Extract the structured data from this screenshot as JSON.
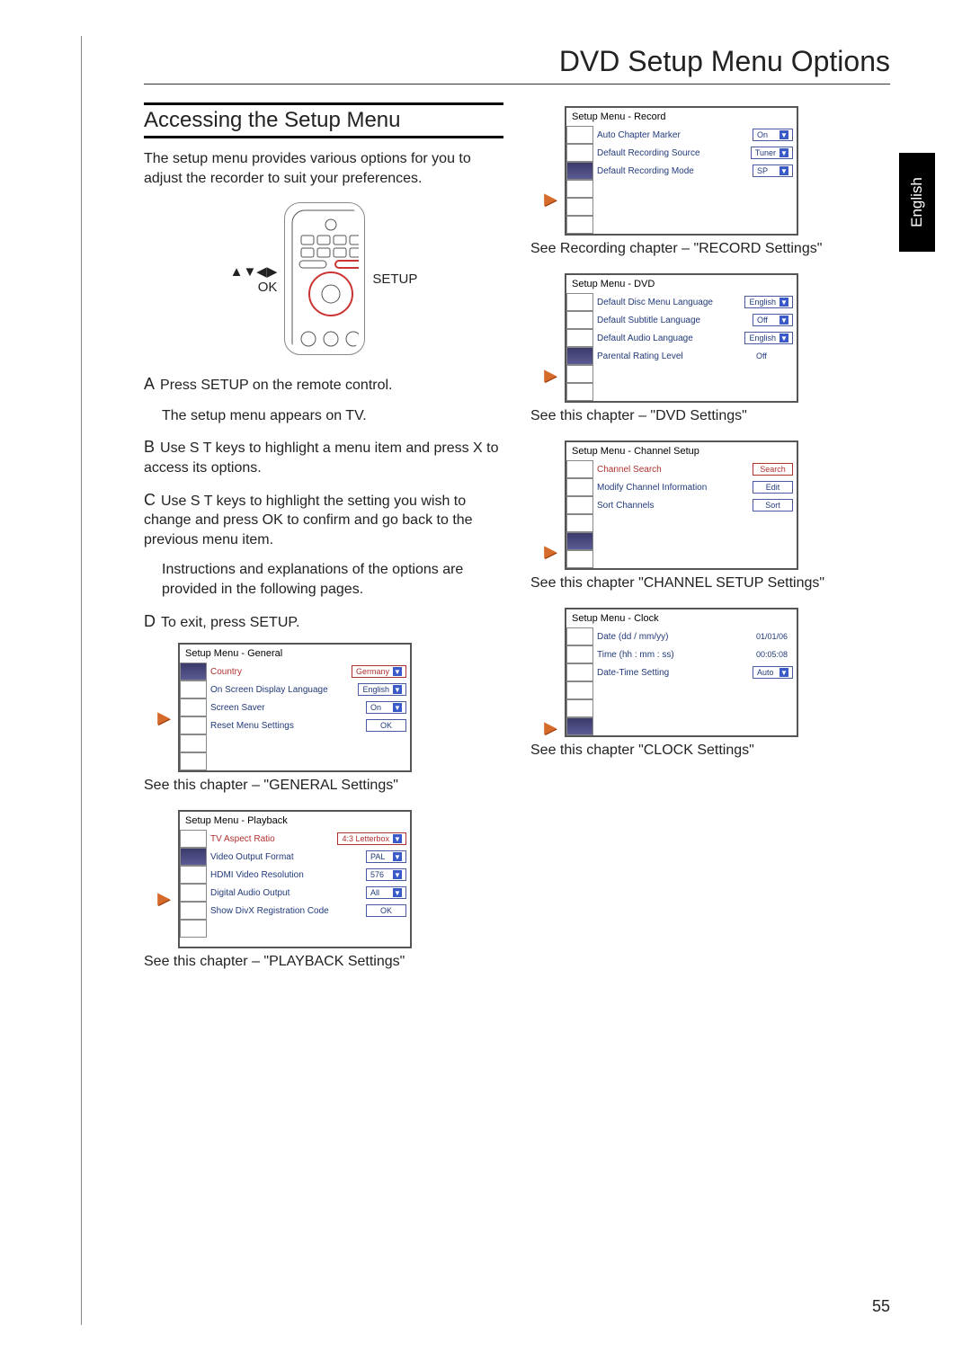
{
  "page_title": "DVD Setup Menu Options",
  "language_tab": "English",
  "page_number": "55",
  "section_heading": "Accessing the Setup Menu",
  "intro": "The setup menu provides various options for you to adjust the recorder to suit your preferences.",
  "remote": {
    "setup_label": "SETUP",
    "arrows_label": "▲▼◀▶",
    "ok_label": "OK"
  },
  "steps": {
    "A": "Press SETUP on the remote control.",
    "A_sub": "The setup menu appears on TV.",
    "B": "Use S T keys to highlight a menu item and press X to access its options.",
    "C": "Use S T keys to highlight the setting you wish to change and press OK to confirm and go back to the previous menu item.",
    "C_sub": "Instructions and explanations of the options are provided in the following pages.",
    "D": "To exit, press SETUP."
  },
  "captions": {
    "general": "See this chapter – \"GENERAL Settings\"",
    "playback": "See this chapter – \"PLAYBACK Settings\"",
    "record": "See Recording chapter – \"RECORD Settings\"",
    "dvd": "See this chapter – \"DVD Settings\"",
    "channel": "See this chapter \"CHANNEL SETUP Settings\"",
    "clock": "See this chapter \"CLOCK Settings\""
  },
  "menus": {
    "general": {
      "title": "Setup Menu - General",
      "rows": [
        {
          "label": "Country",
          "value": "Germany",
          "hl": true,
          "dd": true
        },
        {
          "label": "On Screen Display Language",
          "value": "English",
          "dd": true
        },
        {
          "label": "Screen Saver",
          "value": "On",
          "dd": true
        },
        {
          "label": "Reset Menu Settings",
          "value": "OK",
          "plain": true
        }
      ]
    },
    "playback": {
      "title": "Setup Menu - Playback",
      "rows": [
        {
          "label": "TV Aspect Ratio",
          "value": "4:3 Letterbox",
          "hl": true,
          "dd": true
        },
        {
          "label": "Video Output Format",
          "value": "PAL",
          "dd": true
        },
        {
          "label": "HDMI Video Resolution",
          "value": "576",
          "dd": true
        },
        {
          "label": "Digital Audio Output",
          "value": "All",
          "dd": true
        },
        {
          "label": "Show DivX Registration Code",
          "value": "OK",
          "plain": true
        }
      ]
    },
    "record": {
      "title": "Setup Menu - Record",
      "rows": [
        {
          "label": "Auto Chapter Marker",
          "value": "On",
          "dd": true
        },
        {
          "label": "Default Recording Source",
          "value": "Tuner",
          "dd": true
        },
        {
          "label": "Default Recording Mode",
          "value": "SP",
          "dd": true
        }
      ]
    },
    "dvd": {
      "title": "Setup Menu - DVD",
      "rows": [
        {
          "label": "Default Disc Menu Language",
          "value": "English",
          "dd": true
        },
        {
          "label": "Default Subtitle Language",
          "value": "Off",
          "dd": true
        },
        {
          "label": "Default Audio Language",
          "value": "English",
          "dd": true
        },
        {
          "label": "Parental Rating Level",
          "value": "Off",
          "noborder": true
        }
      ]
    },
    "channel": {
      "title": "Setup Menu - Channel Setup",
      "rows": [
        {
          "label": "Channel Search",
          "value": "Search",
          "hl": true,
          "plain": true
        },
        {
          "label": "Modify Channel Information",
          "value": "Edit",
          "plain": true
        },
        {
          "label": "Sort Channels",
          "value": "Sort",
          "plain": true
        }
      ]
    },
    "clock": {
      "title": "Setup Menu - Clock",
      "rows": [
        {
          "label": "Date (dd / mm/yy)",
          "value": "01/01/06",
          "noborder": true
        },
        {
          "label": "Time (hh : mm : ss)",
          "value": "00:05:08",
          "noborder": true
        },
        {
          "label": "Date-Time Setting",
          "value": "Auto",
          "dd": true
        }
      ]
    }
  }
}
